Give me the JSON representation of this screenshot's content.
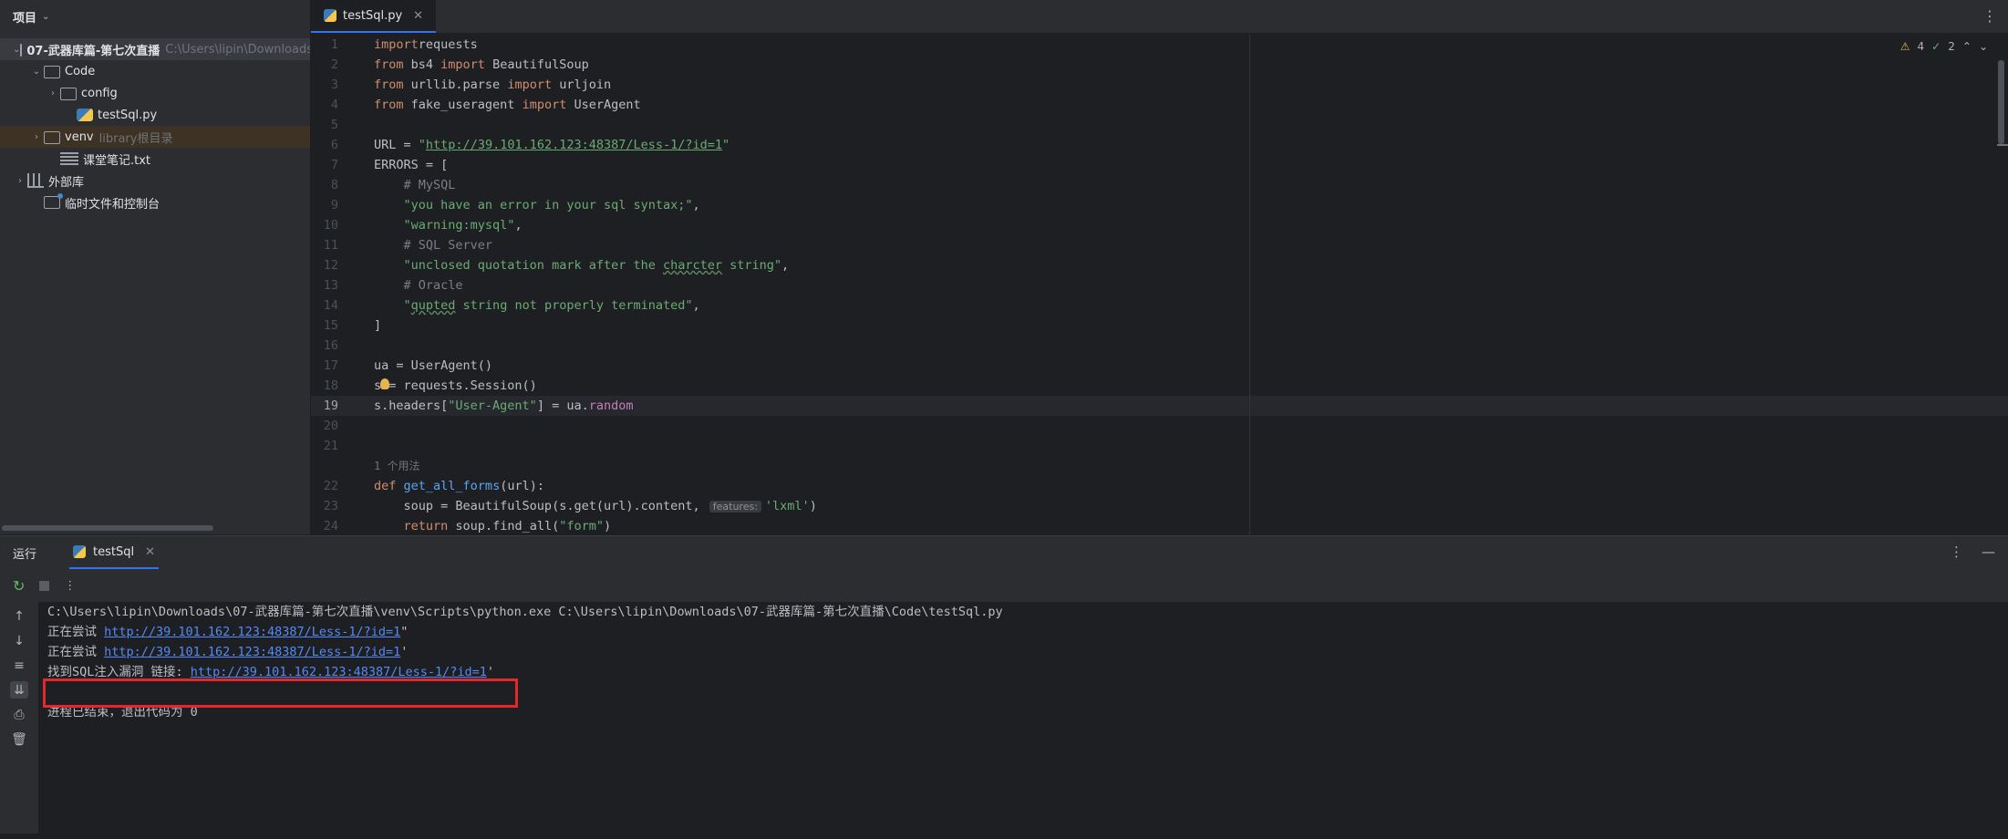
{
  "project": {
    "title": "项目",
    "tree": [
      {
        "label": "07-武器库篇-第七次直播",
        "extra": "C:\\Users\\lipin\\Downloads",
        "type": "folder",
        "indent": 0,
        "arrow": "open"
      },
      {
        "label": "Code",
        "extra": "",
        "type": "folder",
        "indent": 1,
        "arrow": "open"
      },
      {
        "label": "config",
        "extra": "",
        "type": "folder",
        "indent": 2,
        "arrow": "closed"
      },
      {
        "label": "testSql.py",
        "extra": "",
        "type": "python",
        "indent": 3,
        "arrow": ""
      },
      {
        "label": "venv",
        "extra": "library根目录",
        "type": "folder",
        "indent": 1,
        "arrow": "closed"
      },
      {
        "label": "课堂笔记.txt",
        "extra": "",
        "type": "text",
        "indent": 2,
        "arrow": ""
      },
      {
        "label": "外部库",
        "extra": "",
        "type": "library",
        "indent": 0,
        "arrow": "closed"
      },
      {
        "label": "临时文件和控制台",
        "extra": "",
        "type": "scratch",
        "indent": 1,
        "arrow": ""
      }
    ]
  },
  "editor": {
    "tab_label": "testSql.py",
    "warnings_count": "4",
    "ok_count": "2",
    "lines": [
      {
        "n": "1",
        "parts": [
          [
            "kw",
            "import"
          ],
          [
            "",
            "requests"
          ]
        ]
      },
      {
        "n": "2",
        "parts": [
          [
            "kw",
            "from"
          ],
          [
            "",
            " bs4 "
          ],
          [
            "kw",
            "import"
          ],
          [
            "",
            " BeautifulSoup"
          ]
        ]
      },
      {
        "n": "3",
        "parts": [
          [
            "kw",
            "from"
          ],
          [
            "",
            " urllib.parse "
          ],
          [
            "kw",
            "import"
          ],
          [
            "",
            " urljoin"
          ]
        ]
      },
      {
        "n": "4",
        "parts": [
          [
            "kw",
            "from"
          ],
          [
            "",
            " fake_useragent "
          ],
          [
            "kw",
            "import"
          ],
          [
            "",
            " UserAgent"
          ]
        ]
      },
      {
        "n": "5",
        "parts": []
      },
      {
        "n": "6",
        "parts": [
          [
            "",
            "URL = "
          ],
          [
            "str",
            "\""
          ],
          [
            "url",
            "http://39.101.162.123:48387/Less-1/?id=1"
          ],
          [
            "str",
            "\""
          ]
        ]
      },
      {
        "n": "7",
        "parts": [
          [
            "",
            "ERRORS = ["
          ]
        ]
      },
      {
        "n": "8",
        "parts": [
          [
            "cmt",
            "    # MySQL"
          ]
        ]
      },
      {
        "n": "9",
        "parts": [
          [
            "str",
            "    \"you have an error in your sql syntax;\""
          ],
          [
            "",
            ","
          ]
        ]
      },
      {
        "n": "10",
        "parts": [
          [
            "str",
            "    \"warning:mysql\""
          ],
          [
            "",
            ","
          ]
        ]
      },
      {
        "n": "11",
        "parts": [
          [
            "cmt",
            "    # SQL Server"
          ]
        ]
      },
      {
        "n": "12",
        "parts": [
          [
            "str",
            "    \"unclosed quotation mark after the "
          ],
          [
            "str typo",
            "charcter"
          ],
          [
            "str",
            " string\""
          ],
          [
            "",
            ","
          ]
        ]
      },
      {
        "n": "13",
        "parts": [
          [
            "cmt",
            "    # Oracle"
          ]
        ]
      },
      {
        "n": "14",
        "parts": [
          [
            "str",
            "    \""
          ],
          [
            "str typo",
            "qupted"
          ],
          [
            "str",
            " string not properly terminated\""
          ],
          [
            "",
            ","
          ]
        ]
      },
      {
        "n": "15",
        "parts": [
          [
            "",
            "]"
          ]
        ]
      },
      {
        "n": "16",
        "parts": []
      },
      {
        "n": "17",
        "parts": [
          [
            "",
            "ua = UserAgent()"
          ]
        ]
      },
      {
        "n": "18",
        "parts": [
          [
            "",
            "s = requests.Session()"
          ]
        ],
        "bulb": true
      },
      {
        "n": "19",
        "parts": [
          [
            "",
            "s.headers["
          ],
          [
            "str",
            "\"User-Agent\""
          ],
          [
            "",
            "] = ua."
          ],
          [
            "field",
            "random"
          ]
        ],
        "current": true
      },
      {
        "n": "20",
        "parts": []
      },
      {
        "n": "21",
        "parts": []
      },
      {
        "hint": "1 个用法"
      },
      {
        "n": "22",
        "parts": [
          [
            "kw",
            "def"
          ],
          [
            "",
            " "
          ],
          [
            "fn",
            "get_all_forms"
          ],
          [
            "",
            "(url):"
          ]
        ]
      },
      {
        "n": "23",
        "parts": [
          [
            "",
            "    soup = BeautifulSoup(s.get(url).content, "
          ],
          [
            "inlay",
            "features:"
          ],
          [
            "str",
            "'lxml'"
          ],
          [
            "",
            ")"
          ]
        ]
      },
      {
        "n": "24",
        "parts": [
          [
            "",
            "    "
          ],
          [
            "kw",
            "return"
          ],
          [
            "",
            " soup.find_all("
          ],
          [
            "str",
            "\"form\""
          ],
          [
            "",
            ")"
          ]
        ]
      }
    ]
  },
  "run": {
    "title": "运行",
    "tab_label": "testSql",
    "console": {
      "cmd": "C:\\Users\\lipin\\Downloads\\07-武器库篇-第七次直播\\venv\\Scripts\\python.exe C:\\Users\\lipin\\Downloads\\07-武器库篇-第七次直播\\Code\\testSql.py",
      "line1_prefix": "正在尝试 ",
      "line1_url": "http://39.101.162.123:48387/Less-1/?id=1",
      "line1_suffix": "\"",
      "line2_prefix": "正在尝试 ",
      "line2_url": "http://39.101.162.123:48387/Less-1/?id=1",
      "line2_suffix": "'",
      "found_prefix": "找到SQL注入漏洞 链接: ",
      "found_url": "http://39.101.162.123:48387/Less-1/?id=1",
      "found_suffix": "'",
      "exit": "进程已结束，退出代码为 0"
    }
  },
  "colors": {
    "accent": "#3574f0",
    "highlight_box": "#e3282b",
    "link": "#548af7"
  }
}
